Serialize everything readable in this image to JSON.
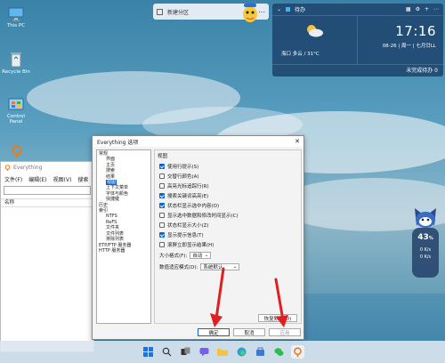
{
  "desktop": {
    "icons": [
      {
        "label": "This PC",
        "icon": "monitor-icon"
      },
      {
        "label": "Recycle Bin",
        "icon": "recycle-bin-icon"
      },
      {
        "label": "Control Panel",
        "icon": "control-panel-icon"
      }
    ]
  },
  "widget_partition": {
    "title": "新建分区",
    "icons": [
      "grid-icon",
      "add-icon",
      "more-icon"
    ]
  },
  "widget_weather": {
    "title": "待办",
    "location": "海口 多云 / 31°C",
    "time": "17:16",
    "date": "08-26 | 周一 | 七月廿LL",
    "footer": "未完成待办 0"
  },
  "everything_window": {
    "title": "Everything",
    "menu": [
      "文件(F)",
      "编辑(E)",
      "视图(V)",
      "搜索"
    ],
    "column_header": "名称"
  },
  "options_dialog": {
    "title": "Everything 选项",
    "tree": [
      {
        "label": "常规",
        "level": 0
      },
      {
        "label": "界面",
        "level": 1
      },
      {
        "label": "主页",
        "level": 1
      },
      {
        "label": "搜索",
        "level": 1
      },
      {
        "label": "结果",
        "level": 1
      },
      {
        "label": "视图",
        "level": 1,
        "selected": true
      },
      {
        "label": "上下文菜单",
        "level": 1
      },
      {
        "label": "字体与颜色",
        "level": 1
      },
      {
        "label": "快捷键",
        "level": 1
      },
      {
        "label": "历史",
        "level": 0
      },
      {
        "label": "索引",
        "level": 0
      },
      {
        "label": "NTFS",
        "level": 1
      },
      {
        "label": "ReFS",
        "level": 1
      },
      {
        "label": "文件夹",
        "level": 1
      },
      {
        "label": "文件列表",
        "level": 1
      },
      {
        "label": "排除列表",
        "level": 1
      },
      {
        "label": "ETP/FTP 服务器",
        "level": 0
      },
      {
        "label": "HTTP 服务器",
        "level": 0
      }
    ],
    "panel_title": "视图",
    "options": [
      {
        "label": "使用行提示(S)",
        "checked": true
      },
      {
        "label": "交替行颜色(A)",
        "checked": false
      },
      {
        "label": "高亮光标追踪行(R)",
        "checked": false
      },
      {
        "label": "搜索关键词高亮(E)",
        "checked": true
      },
      {
        "label": "状态栏显示选中内容(O)",
        "checked": true
      },
      {
        "label": "显示选中数据和修改时间显示(C)",
        "checked": false
      },
      {
        "label": "状态栏显示大小(Z)",
        "checked": false
      },
      {
        "label": "显示提示信息(T)",
        "checked": true
      },
      {
        "label": "滚屏立即显示结果(H)",
        "checked": false
      }
    ],
    "size_format_label": "大小格式(F):",
    "size_format_value": "自动",
    "scrollbar_label": "数值适应模式(D):",
    "scrollbar_value": "系统默认",
    "restore_defaults": "恢复默认(D)",
    "ok": "确定",
    "cancel": "取消",
    "apply": "应用"
  },
  "gadget": {
    "percent": "43",
    "unit": "%",
    "up": "0 K/s",
    "down": "0 K/s"
  },
  "taskbar": {
    "icons": [
      "start-icon",
      "search-icon",
      "task-view-icon",
      "chat-icon",
      "file-explorer-icon",
      "edge-icon",
      "store-icon",
      "wechat-icon",
      "everything-icon"
    ]
  },
  "colors": {
    "accent": "#0a64d8",
    "arrow": "#e02020"
  }
}
